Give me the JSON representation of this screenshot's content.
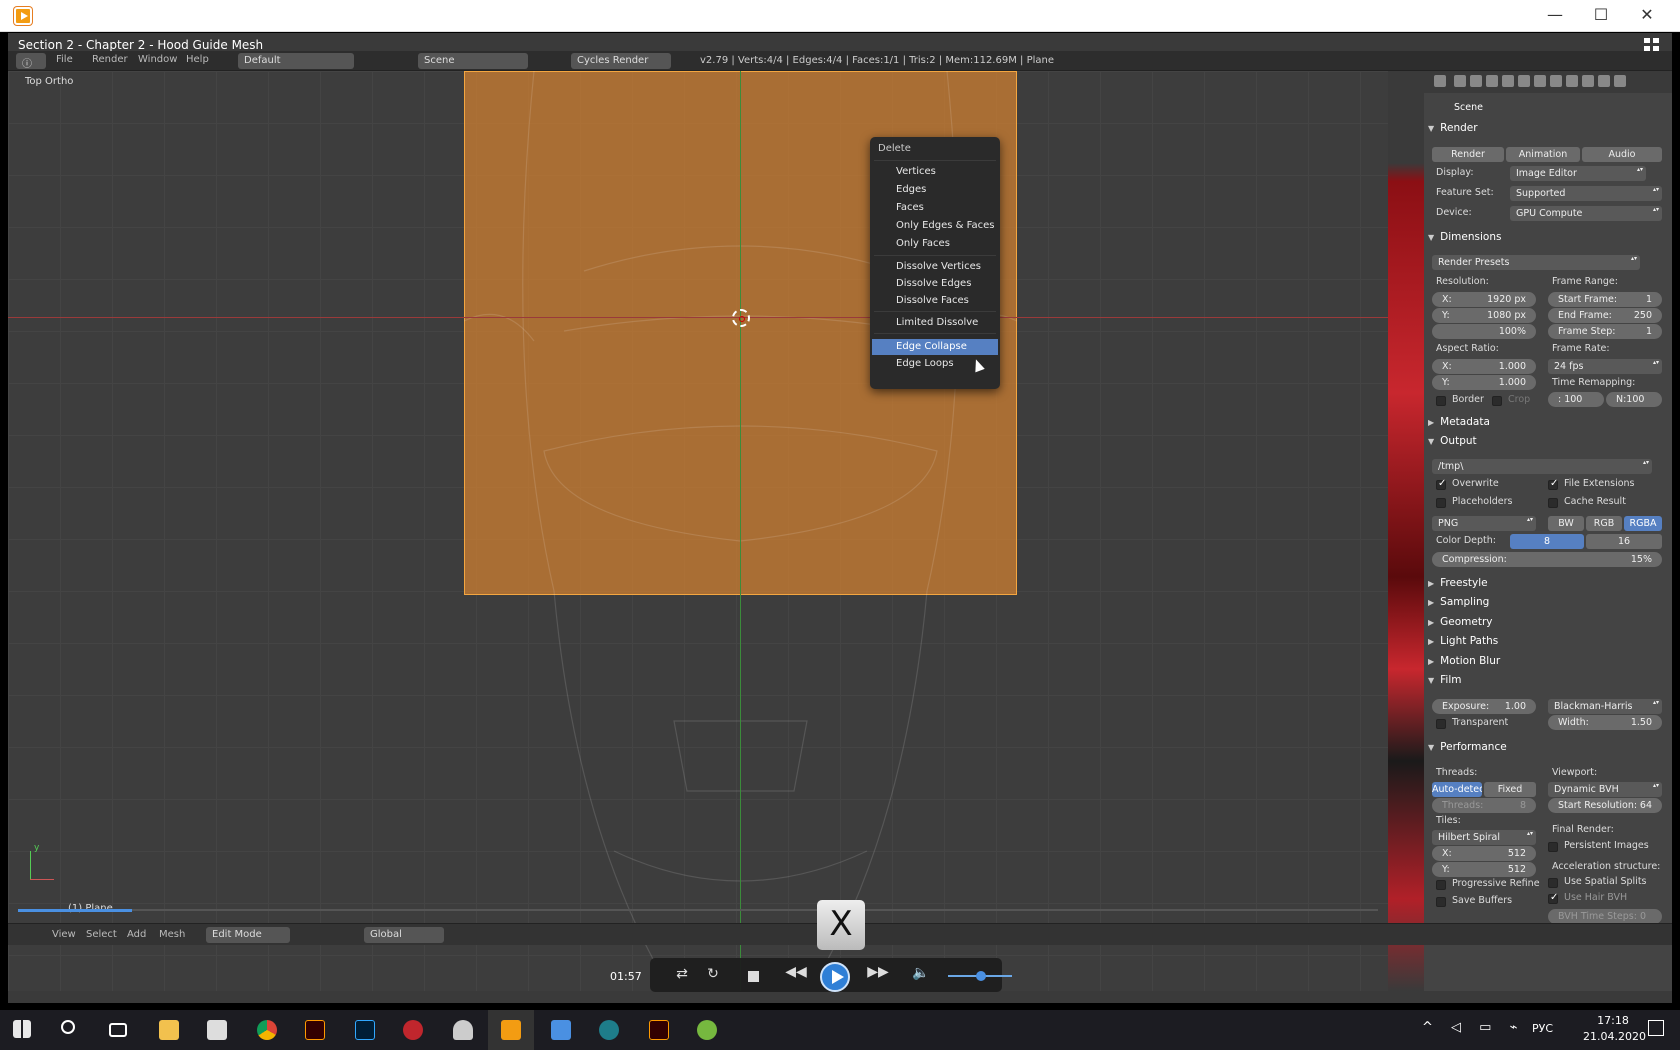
{
  "window": {
    "title": "Section 2 - Chapter 2 - Hood Guide Mesh",
    "min": "—",
    "max": "☐",
    "close": "✕"
  },
  "header": {
    "menus": [
      "File",
      "Render",
      "Window",
      "Help"
    ],
    "layout": "Default",
    "scene": "Scene",
    "engine": "Cycles Render",
    "status": "v2.79 | Verts:4/4 | Edges:4/4 | Faces:1/1 | Tris:2 | Mem:112.69M | Plane"
  },
  "viewport": {
    "label": "Top Ortho",
    "object": "(1) Plane",
    "axis_y": "y"
  },
  "delete_menu": {
    "title": "Delete",
    "items": [
      "Vertices",
      "Edges",
      "Faces",
      "Only Edges & Faces",
      "Only Faces",
      "Dissolve Vertices",
      "Dissolve Edges",
      "Dissolve Faces",
      "Limited Dissolve",
      "Edge Collapse",
      "Edge Loops"
    ],
    "selected": "Edge Collapse"
  },
  "props": {
    "context": "Scene",
    "render": {
      "title": "Render",
      "buttons": [
        "Render",
        "Animation",
        "Audio"
      ],
      "display_label": "Display:",
      "display": "Image Editor",
      "feature_label": "Feature Set:",
      "feature": "Supported",
      "device_label": "Device:",
      "device": "GPU Compute"
    },
    "dimensions": {
      "title": "Dimensions",
      "presets": "Render Presets",
      "res_label": "Resolution:",
      "res_x_label": "X:",
      "res_x": "1920 px",
      "res_y_label": "Y:",
      "res_y": "1080 px",
      "res_pct": "100%",
      "frame_range": "Frame Range:",
      "start_label": "Start Frame:",
      "start": "1",
      "end_label": "End Frame:",
      "end": "250",
      "step_label": "Frame Step:",
      "step": "1",
      "aspect": "Aspect Ratio:",
      "ax_label": "X:",
      "ax": "1.000",
      "ay_label": "Y:",
      "ay": "1.000",
      "frame_rate": "Frame Rate:",
      "fps": "24 fps",
      "time_remap": "Time Remapping:",
      "old": ": 100",
      "new": "N:100",
      "border": "Border",
      "crop": "Crop"
    },
    "metadata": "Metadata",
    "output": {
      "title": "Output",
      "path": "/tmp\\",
      "overwrite": "Overwrite",
      "file_ext": "File Extensions",
      "placeholders": "Placeholders",
      "cache": "Cache Result",
      "format": "PNG",
      "bw": "BW",
      "rgb": "RGB",
      "rgba": "RGBA",
      "depth_label": "Color Depth:",
      "d8": "8",
      "d16": "16",
      "comp_label": "Compression:",
      "comp": "15%"
    },
    "freestyle": "Freestyle",
    "sampling": "Sampling",
    "geometry": "Geometry",
    "light_paths": "Light Paths",
    "motion_blur": "Motion Blur",
    "film": {
      "title": "Film",
      "exp_label": "Exposure:",
      "exp": "1.00",
      "filter": "Blackman-Harris",
      "transparent": "Transparent",
      "width_label": "Width:",
      "width": "1.50"
    },
    "performance": {
      "title": "Performance",
      "threads": "Threads:",
      "auto": "Auto-detect",
      "fixed": "Fixed",
      "threads_count_label": "Threads:",
      "threads_count": "8",
      "viewport": "Viewport:",
      "bvh": "Dynamic BVH",
      "start_res_label": "Start Resolution:",
      "start_res": "64",
      "tiles": "Tiles:",
      "tile_order": "Hilbert Spiral",
      "tx_label": "X:",
      "tx": "512",
      "ty_label": "Y:",
      "ty": "512",
      "final": "Final Render:",
      "persistent": "Persistent Images",
      "accel": "Acceleration structure:",
      "spatial": "Use Spatial Splits",
      "hair_bvh": "Use Hair BVH",
      "bvh_steps": "BVH Time Steps: 0",
      "progressive": "Progressive Refine",
      "save_buffers": "Save Buffers"
    }
  },
  "footer": {
    "view": "View",
    "select": "Select",
    "add": "Add",
    "mesh": "Mesh",
    "mode": "Edit Mode",
    "orientation": "Global"
  },
  "player": {
    "time": "01:57",
    "overlay_key": "X",
    "volume": 0.5
  },
  "taskbar": {
    "lang": "РУС",
    "time": "17:18",
    "date": "21.04.2020"
  }
}
